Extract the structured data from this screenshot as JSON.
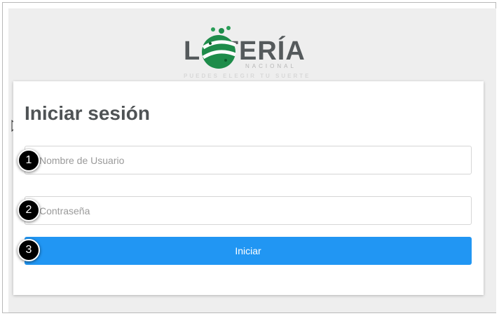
{
  "logo": {
    "brand_text": "LOTERÍA",
    "subtitle": "NACIONAL",
    "tagline": "PUEDES ELEGIR TU SUERTE"
  },
  "login": {
    "title": "Iniciar sesión",
    "username_placeholder": "Nombre de Usuario",
    "password_placeholder": "Contraseña",
    "submit_label": "Iniciar"
  },
  "steps": [
    "1",
    "2",
    "3"
  ],
  "colors": {
    "primary_button": "#2196f3",
    "logo_green": "#1e8c4a",
    "title_text": "#4f5355"
  },
  "icons": {
    "cursor": "mouse-pointer-icon",
    "logo_ball": "lottery-ball-icon"
  }
}
